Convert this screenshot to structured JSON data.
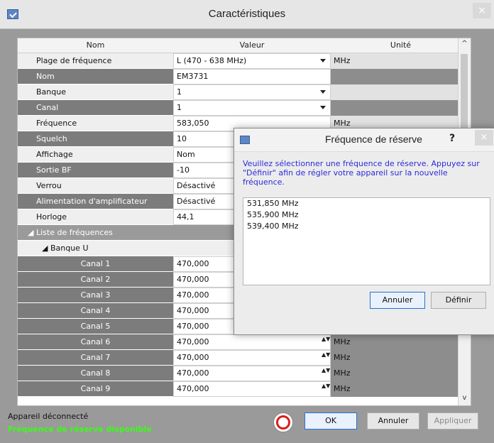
{
  "window": {
    "title": "Caractéristiques",
    "close_label": "×"
  },
  "table": {
    "headers": [
      "Nom",
      "Valeur",
      "Unité"
    ],
    "rows": [
      {
        "name": "Plage de fréquence",
        "value": "L (470 - 638 MHz)",
        "unit": "MHz",
        "type": "dropdown"
      },
      {
        "name": "Nom",
        "value": "EM3731",
        "unit": "",
        "type": "text"
      },
      {
        "name": "Banque",
        "value": "1",
        "unit": "",
        "type": "dropdown"
      },
      {
        "name": "Canal",
        "value": "1",
        "unit": "",
        "type": "dropdown"
      },
      {
        "name": "Fréquence",
        "value": "583,050",
        "unit": "MHz",
        "type": "text"
      },
      {
        "name": "Squelch",
        "value": "10",
        "unit": "",
        "type": "text"
      },
      {
        "name": "Affichage",
        "value": "Nom",
        "unit": "",
        "type": "text"
      },
      {
        "name": "Sortie BF",
        "value": "-10",
        "unit": "",
        "type": "text"
      },
      {
        "name": "Verrou",
        "value": "Désactivé",
        "unit": "",
        "type": "text"
      },
      {
        "name": "Alimentation d'amplificateur",
        "value": "Désactivé",
        "unit": "",
        "type": "text"
      },
      {
        "name": "Horloge",
        "value": "44,1",
        "unit": "",
        "type": "text"
      }
    ],
    "tree": {
      "group_label": "Liste de fréquences",
      "bank_label": "Banque U",
      "channels": [
        {
          "name": "Canal 1",
          "value": "470,000",
          "unit": ""
        },
        {
          "name": "Canal 2",
          "value": "470,000",
          "unit": ""
        },
        {
          "name": "Canal 3",
          "value": "470,000",
          "unit": ""
        },
        {
          "name": "Canal 4",
          "value": "470,000",
          "unit": ""
        },
        {
          "name": "Canal 5",
          "value": "470,000",
          "unit": ""
        },
        {
          "name": "Canal 6",
          "value": "470,000",
          "unit": "MHz"
        },
        {
          "name": "Canal 7",
          "value": "470,000",
          "unit": "MHz"
        },
        {
          "name": "Canal 8",
          "value": "470,000",
          "unit": "MHz"
        },
        {
          "name": "Canal 9",
          "value": "470,000",
          "unit": "MHz"
        }
      ]
    }
  },
  "status": {
    "line1": "Appareil déconnecté",
    "line2": "Fréquence de réserve disponible",
    "line2_color": "#39ff14"
  },
  "buttons": {
    "ok": "OK",
    "cancel": "Annuler",
    "apply": "Appliquer"
  },
  "modal": {
    "title": "Fréquence de réserve",
    "help": "?",
    "close_label": "×",
    "message": "Veuillez sélectionner une fréquence de réserve. Appuyez sur \"Définir\" afin de régler votre appareil sur la nouvelle fréquence.",
    "options": [
      "531,850 MHz",
      "535,900 MHz",
      "539,400 MHz"
    ],
    "cancel_label": "Annuler",
    "set_label": "Définir"
  },
  "icons": [
    "app-icon",
    "close-icon",
    "dropdown-arrow-icon",
    "spinner-icon",
    "scroll-up-icon",
    "scroll-down-icon",
    "lifebuoy-icon",
    "help-icon"
  ],
  "colors": {
    "message_text": "#2b2bdb",
    "status_green": "#39ff14"
  }
}
